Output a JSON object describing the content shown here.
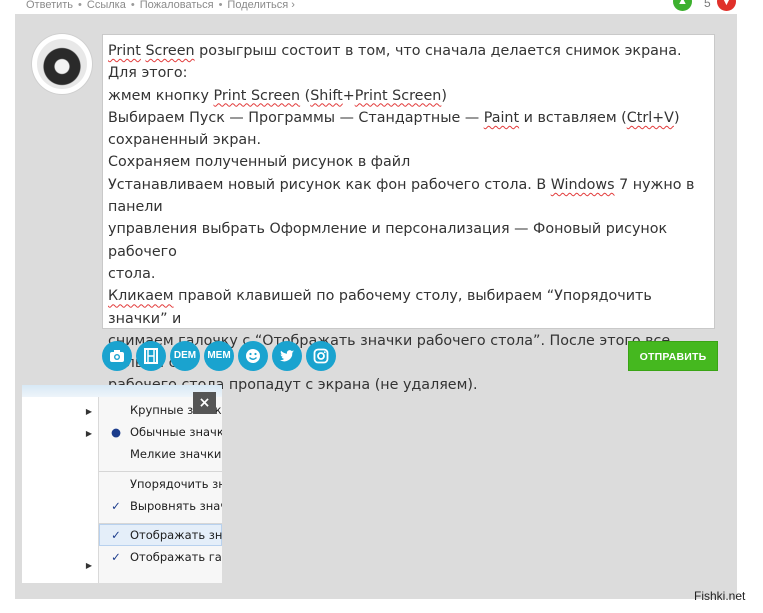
{
  "topbar": {
    "links": [
      "Ответить",
      "Ссылка",
      "Пожаловаться",
      "Поделиться ›"
    ],
    "separator": "•",
    "vote_up_icon": "thumb-up-icon",
    "vote_count": "5",
    "vote_down_icon": "thumb-down-icon"
  },
  "comment": {
    "lines": [
      "Print Screen розыгрыш состоит в том, что сначала делается снимок экрана.",
      "Для этого:",
      "жмем кнопку Print Screen (Shift+Print Screen)",
      "Выбираем Пуск — Программы — Стандартные — Paint и вставляем (Ctrl+V)",
      "сохраненный экран.",
      "Сохраняем полученный рисунок в файл",
      "Устанавливаем новый рисунок как фон рабочего стола. В Windows 7 нужно в панели",
      "управления выбрать Оформление и персонализация — Фоновый рисунок рабочего",
      "стола.",
      "Кликаем правой клавишей по рабочему столу, выбираем “Упорядочить значки” и",
      "снимаем галочку с “Отображать значки рабочего стола”. После этого все ярлыки с",
      "рабочего стола пропадут с экрана (не удаляем)."
    ]
  },
  "toolbar": {
    "buttons": [
      {
        "icon": "camera-icon",
        "label": ""
      },
      {
        "icon": "film-icon",
        "label": ""
      },
      {
        "icon": "dem-icon",
        "label": "DEM"
      },
      {
        "icon": "mem-icon",
        "label": "MEM"
      },
      {
        "icon": "smiley-icon",
        "label": ""
      },
      {
        "icon": "twitter-icon",
        "label": ""
      },
      {
        "icon": "instagram-icon",
        "label": ""
      }
    ],
    "send_label": "ОТПРАВИТЬ",
    "colors": {
      "button": "#1aa3cf",
      "send": "#45b81f"
    }
  },
  "attachment": {
    "close_label": "×",
    "menu_items": [
      {
        "label": "Крупные значки",
        "mark": ""
      },
      {
        "label": "Обычные значки",
        "mark": "●"
      },
      {
        "label": "Мелкие значки",
        "mark": ""
      },
      {
        "label": "Упорядочить значки",
        "mark": ""
      },
      {
        "label": "Выровнять значки по",
        "mark": "✓"
      },
      {
        "label": "Отображать значки р",
        "mark": "✓"
      },
      {
        "label": "Отображать гаджеты",
        "mark": "✓"
      }
    ]
  },
  "watermark": "Fishki.net"
}
